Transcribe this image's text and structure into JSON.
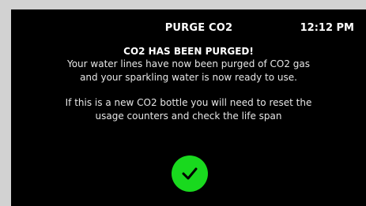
{
  "header": {
    "title": "PURGE CO2",
    "time": "12:12 PM"
  },
  "message": {
    "title": "CO2 HAS BEEN PURGED!",
    "lines": [
      "Your water lines have now been purged of CO2 gas",
      "and your sparkling water is now ready to use.",
      "If this is a new CO2 bottle you will need to reset the",
      "usage counters and check the life span"
    ]
  },
  "ok_button": {
    "icon": "checkmark-icon",
    "color": "#19d91e"
  }
}
